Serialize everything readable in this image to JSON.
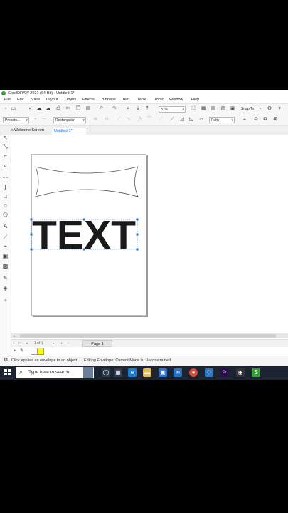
{
  "window": {
    "title": "CorelDRAW 2021 (64-Bit) - Untitled-1*"
  },
  "menu": [
    "File",
    "Edit",
    "View",
    "Layout",
    "Object",
    "Effects",
    "Bitmaps",
    "Text",
    "Table",
    "Tools",
    "Window",
    "Help"
  ],
  "toolbar": {
    "zoom": "31%",
    "snap_to": "Snap To"
  },
  "propbar": {
    "presets": "Presets...",
    "mode": "Rectangular",
    "envelope_mode": "Putty"
  },
  "tabs": {
    "welcome": "Welcome Screen",
    "document": "Untitled-1*",
    "add": "+"
  },
  "document": {
    "text": "TEXT"
  },
  "pagenav": {
    "page_count": "1  of  1",
    "page_tab": "Page 1"
  },
  "status": {
    "hint": "Click applies an envelope to an object",
    "editing": "Editing Envelope: Current Mode is: Unconstrained"
  },
  "taskbar": {
    "search_placeholder": "Type here to search"
  },
  "colors": {
    "fill": "#ffff00",
    "accent": "#1e6ec8",
    "app_bg": "#ffffff",
    "video_bars": "#000000"
  }
}
